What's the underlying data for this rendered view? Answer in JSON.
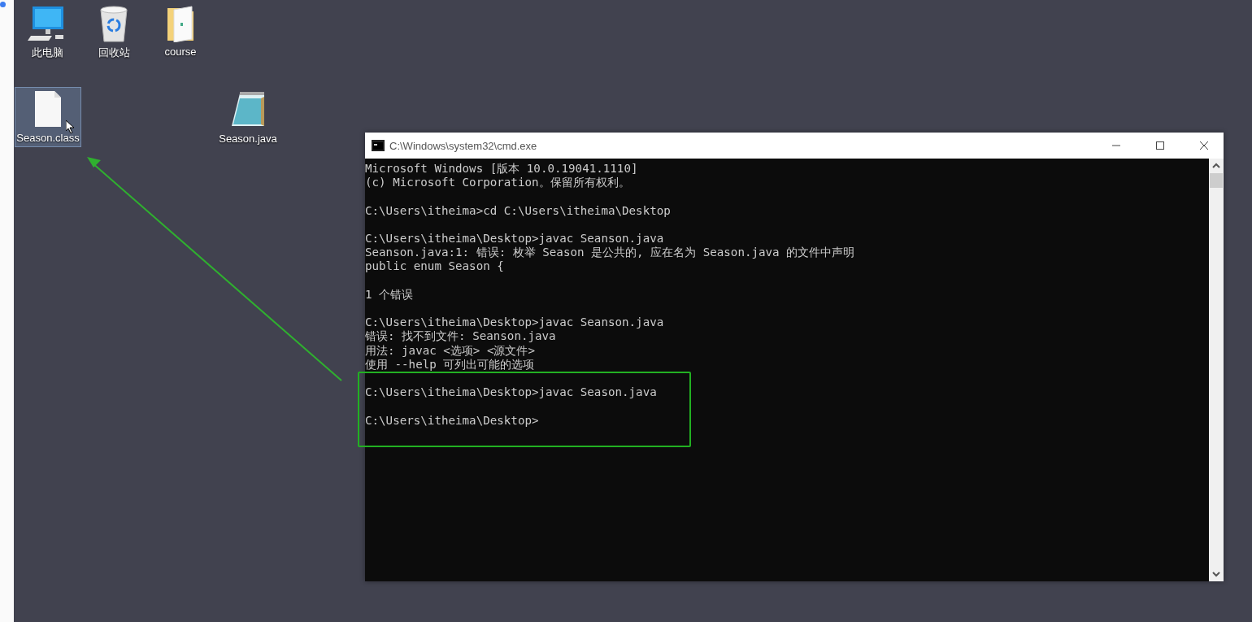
{
  "desktop_icons": [
    {
      "kind": "computer",
      "label": "此电脑",
      "selected": false
    },
    {
      "kind": "recycle-bin",
      "label": "回收站",
      "selected": false
    },
    {
      "kind": "folder",
      "label": "course",
      "selected": false
    },
    {
      "kind": "file",
      "label": "Season.class",
      "selected": true
    },
    {
      "kind": "notepad",
      "label": "Season.java",
      "selected": false
    }
  ],
  "window": {
    "title": "C:\\Windows\\system32\\cmd.exe",
    "blocks": [
      [
        "Microsoft Windows [版本 10.0.19041.1110]",
        "(c) Microsoft Corporation。保留所有权利。"
      ],
      [
        "C:\\Users\\itheima>cd C:\\Users\\itheima\\Desktop"
      ],
      [
        "C:\\Users\\itheima\\Desktop>javac Seanson.java",
        "Seanson.java:1: 错误: 枚举 Season 是公共的, 应在名为 Season.java 的文件中声明",
        "public enum Season {"
      ],
      [
        "1 个错误"
      ],
      [
        "C:\\Users\\itheima\\Desktop>javac Seanson.java",
        "错误: 找不到文件: Seanson.java",
        "用法: javac <选项> <源文件>",
        "使用 --help 可列出可能的选项"
      ],
      [
        "C:\\Users\\itheima\\Desktop>javac Season.java"
      ],
      [
        "C:\\Users\\itheima\\Desktop>"
      ]
    ]
  }
}
